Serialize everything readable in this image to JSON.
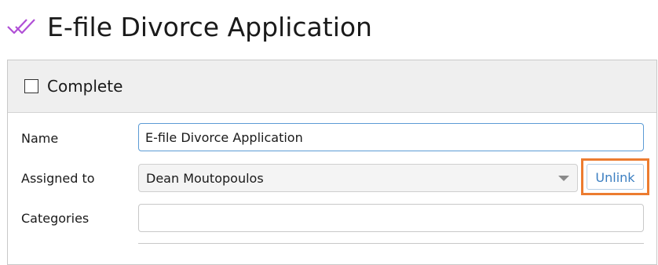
{
  "header": {
    "title": "E-file Divorce Application",
    "icon": "double-check-icon",
    "icon_color": "#b04fd6"
  },
  "panel": {
    "complete": {
      "label": "Complete",
      "checked": false
    },
    "fields": {
      "name": {
        "label": "Name",
        "value": "E-file Divorce Application"
      },
      "assigned_to": {
        "label": "Assigned to",
        "value": "Dean Moutopoulos",
        "unlink_label": "Unlink"
      },
      "categories": {
        "label": "Categories",
        "value": ""
      }
    }
  },
  "colors": {
    "highlight": "#ec7c30",
    "focus_border": "#5b9bd5",
    "link": "#3c7fc1"
  }
}
